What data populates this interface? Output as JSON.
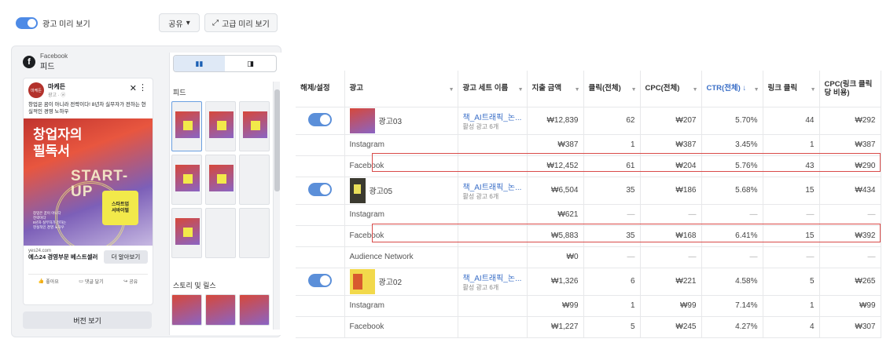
{
  "preview": {
    "toggle_label": "광고 미리 보기",
    "share_label": "공유",
    "advanced_label": "고급 미리 보기",
    "placement_platform": "Facebook",
    "placement_name": "피드",
    "ad": {
      "page_name": "마케든",
      "page_sub": "광고 · ⓦ",
      "avatar_text": "마케든",
      "primary_text": "창업은 꿈이 아니라 전략이다! 8년차 실무자가 전하는 현실적인 경영 노하우",
      "image_title": "창업자의\n필독서",
      "image_start": "START-\nUP",
      "image_badge": "스타트업\n서바이벌",
      "image_small": "창업은 꿈이 아니다\n전략이다\n8년차 실무자가 전하는\n현실적인 경영 노하우",
      "url": "yes24.com",
      "headline": "예스24 경영부문 베스트셀러",
      "cta": "더 알아보기",
      "like": "좋아요",
      "comment": "댓글 달기",
      "share": "공유"
    },
    "version_button": "버전 보기",
    "feed_section": "피드",
    "story_section": "스토리 및 릴스"
  },
  "table": {
    "headers": [
      "해제/설정",
      "광고",
      "광고 세트 이름",
      "지출 금액",
      "클릭(전체)",
      "CPC(전체)",
      "CTR(전체) ↓",
      "링크 클릭",
      "CPC(링크 클릭당 비용)"
    ],
    "rows": [
      {
        "kind": "parent",
        "ad": "광고03",
        "set": "책_AI트래픽_논...",
        "set_meta": "활성 광고 6개",
        "spend": "₩12,839",
        "clicks": "62",
        "cpc": "₩207",
        "ctr": "5.70%",
        "link_clicks": "44",
        "cpc_link": "₩292"
      },
      {
        "kind": "sub",
        "ad": "Instagram",
        "spend": "₩387",
        "clicks": "1",
        "cpc": "₩387",
        "ctr": "3.45%",
        "link_clicks": "1",
        "cpc_link": "₩387"
      },
      {
        "kind": "sub",
        "ad": "Facebook",
        "spend": "₩12,452",
        "clicks": "61",
        "cpc": "₩204",
        "ctr": "5.76%",
        "link_clicks": "43",
        "cpc_link": "₩290"
      },
      {
        "kind": "parent",
        "ad": "광고05",
        "set": "책_AI트래픽_논...",
        "set_meta": "활성 광고 6개",
        "spend": "₩6,504",
        "clicks": "35",
        "cpc": "₩186",
        "ctr": "5.68%",
        "link_clicks": "15",
        "cpc_link": "₩434"
      },
      {
        "kind": "sub",
        "ad": "Instagram",
        "spend": "₩621",
        "clicks": "—",
        "cpc": "—",
        "ctr": "—",
        "link_clicks": "—",
        "cpc_link": "—"
      },
      {
        "kind": "sub",
        "ad": "Facebook",
        "spend": "₩5,883",
        "clicks": "35",
        "cpc": "₩168",
        "ctr": "6.41%",
        "link_clicks": "15",
        "cpc_link": "₩392"
      },
      {
        "kind": "sub",
        "ad": "Audience Network",
        "spend": "₩0",
        "clicks": "—",
        "cpc": "—",
        "ctr": "—",
        "link_clicks": "—",
        "cpc_link": "—"
      },
      {
        "kind": "parent",
        "ad": "광고02",
        "set": "책_AI트래픽_논...",
        "set_meta": "활성 광고 6개",
        "spend": "₩1,326",
        "clicks": "6",
        "cpc": "₩221",
        "ctr": "4.58%",
        "link_clicks": "5",
        "cpc_link": "₩265"
      },
      {
        "kind": "sub",
        "ad": "Instagram",
        "spend": "₩99",
        "clicks": "1",
        "cpc": "₩99",
        "ctr": "7.14%",
        "link_clicks": "1",
        "cpc_link": "₩99"
      },
      {
        "kind": "sub",
        "ad": "Facebook",
        "spend": "₩1,227",
        "clicks": "5",
        "cpc": "₩245",
        "ctr": "4.27%",
        "link_clicks": "4",
        "cpc_link": "₩307"
      }
    ]
  },
  "colors": {
    "accent": "#4d8ae6",
    "highlight": "#d94a48",
    "link": "#3b6fc7"
  }
}
